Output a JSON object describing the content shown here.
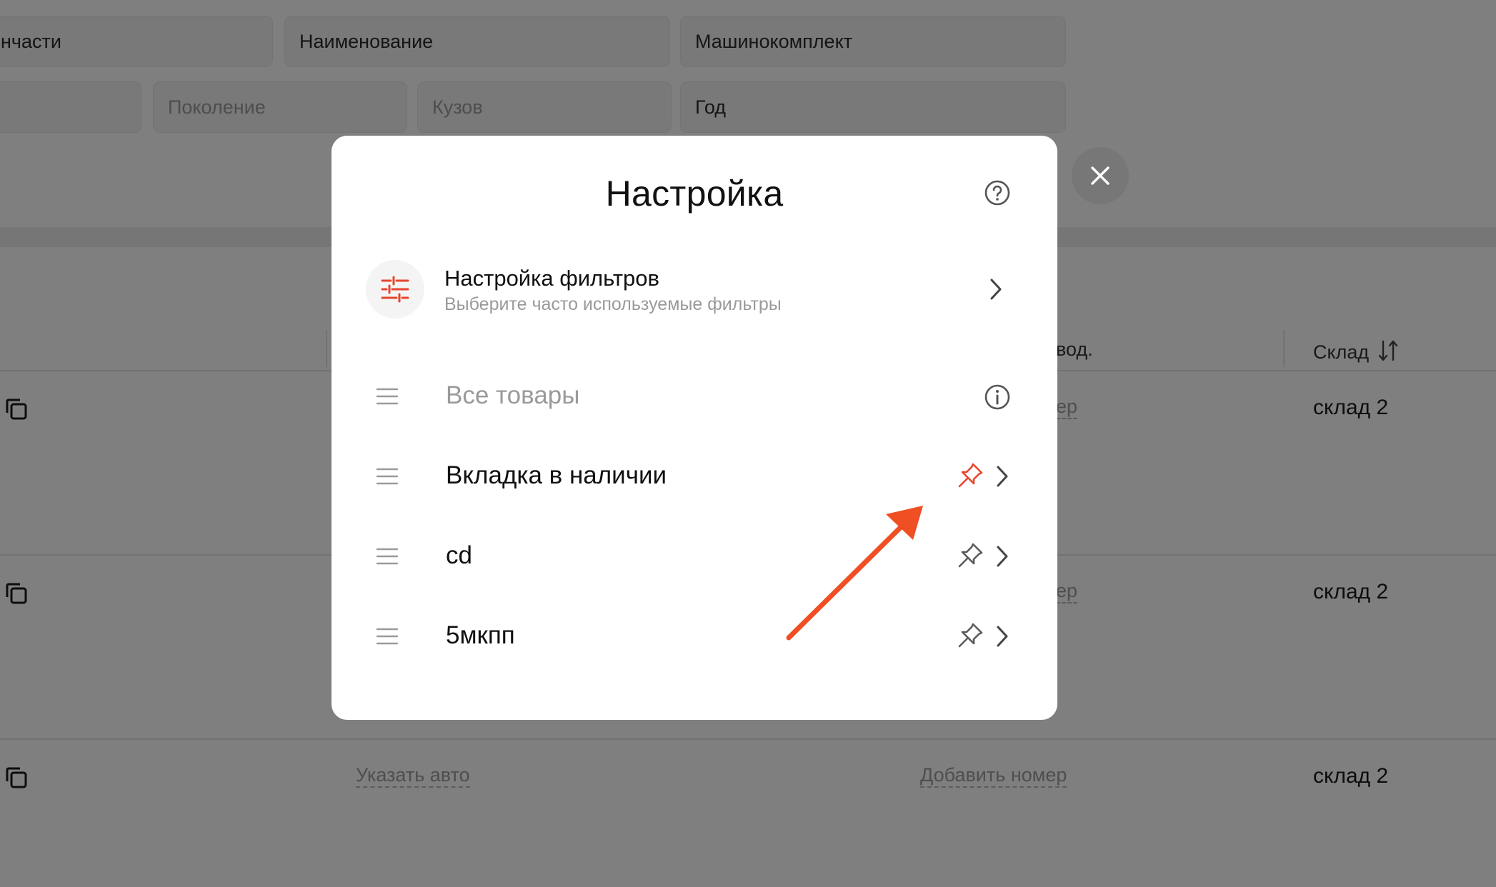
{
  "background": {
    "filters_row1": [
      "нчасти",
      "Наименование",
      "Машинокомплект"
    ],
    "filters_row2": [
      "",
      "Поколение",
      "Кузов",
      "Год"
    ],
    "table": {
      "header_partial": "вод.",
      "header_warehouse": "Склад",
      "rows": [
        {
          "number_partial": "ер",
          "warehouse": "склад 2"
        },
        {
          "number_partial": "ер",
          "warehouse": "склад 2"
        },
        {
          "car_link": "Указать авто",
          "number_link": "Добавить номер",
          "warehouse": "склад 2"
        }
      ]
    }
  },
  "modal": {
    "title": "Настройка",
    "filters_setting": {
      "title": "Настройка фильтров",
      "subtitle": "Выберите часто используемые фильтры"
    },
    "tabs": [
      {
        "label": "Все товары",
        "muted": true,
        "icon": "info-icon"
      },
      {
        "label": "Вкладка в наличии",
        "pinned": true,
        "icon": "pin-icon"
      },
      {
        "label": "cd",
        "pinned": false,
        "icon": "pin-icon"
      },
      {
        "label": "5мкпп",
        "pinned": false,
        "icon": "pin-icon"
      }
    ]
  },
  "colors": {
    "accent": "#e8452c",
    "annotation_arrow": "#f04e23",
    "pin_inactive": "#5a5a5a"
  }
}
